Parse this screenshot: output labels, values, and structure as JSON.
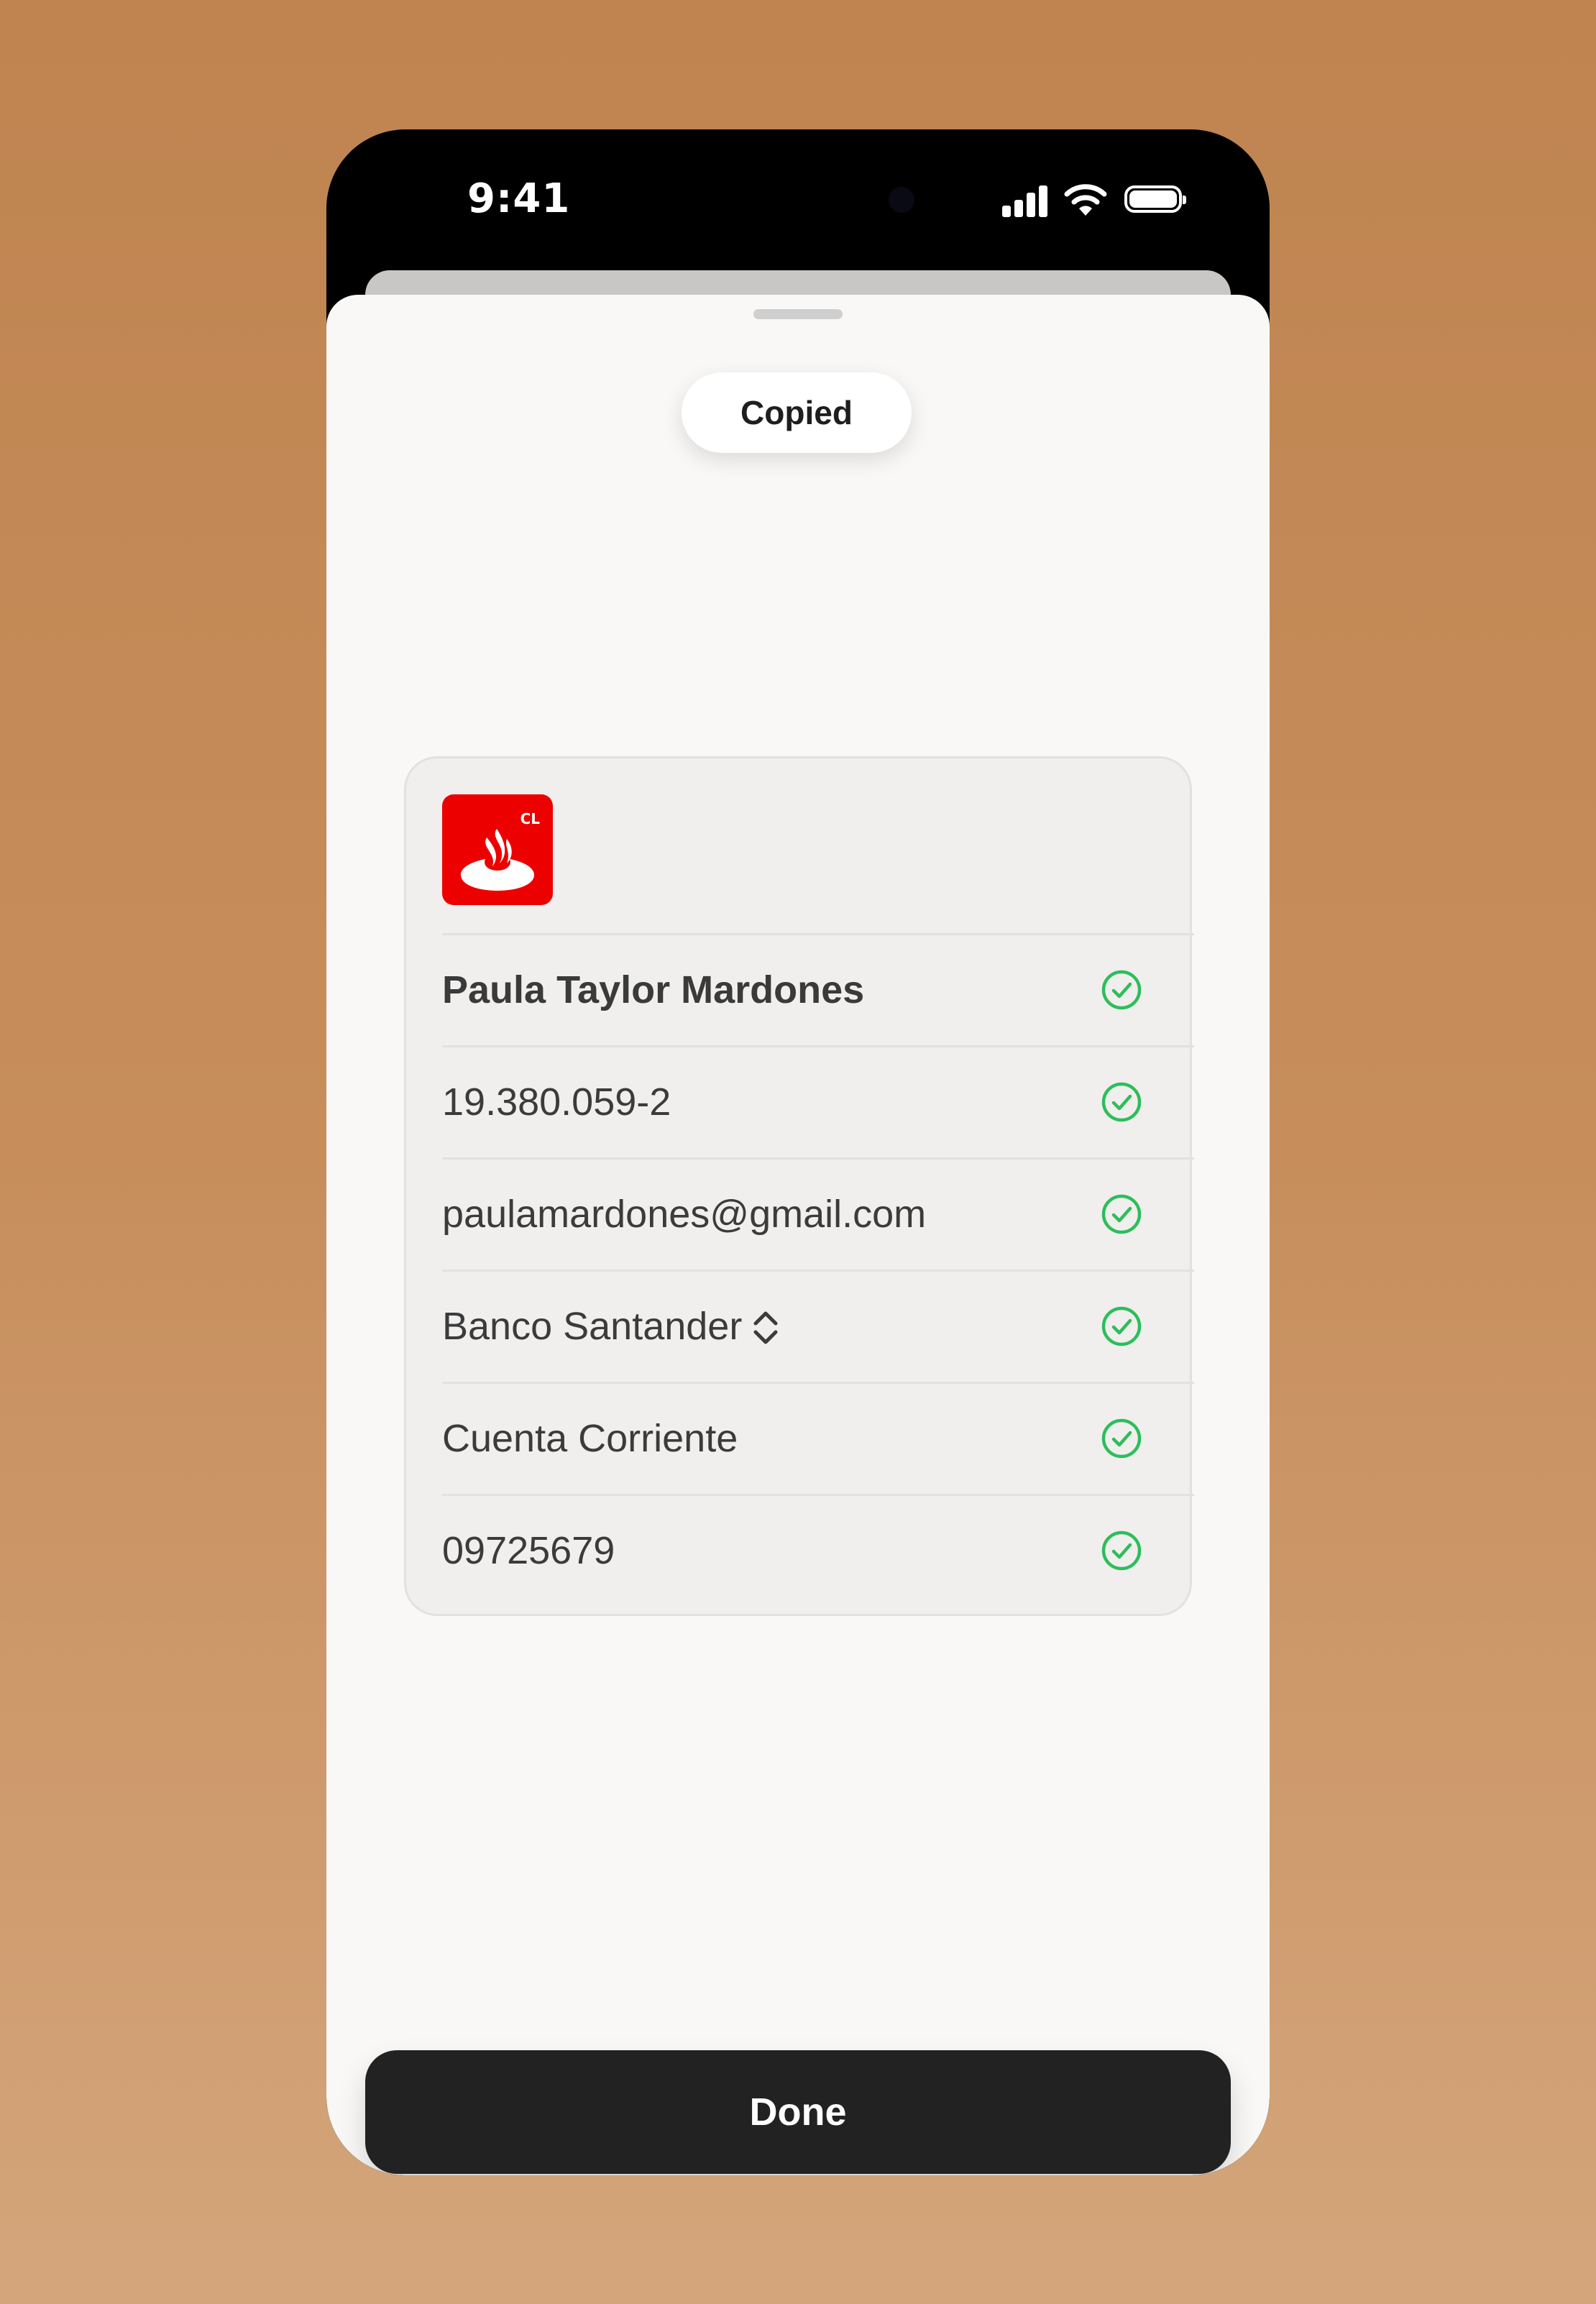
{
  "status_bar": {
    "time": "9:41"
  },
  "toast": {
    "label": "Copied"
  },
  "bank_logo": {
    "region": "CL",
    "brand_color": "#EC0000"
  },
  "rows": [
    {
      "label": "Paula Taylor Mardones",
      "bold": true
    },
    {
      "label": "19.380.059-2"
    },
    {
      "label": "paulamardones@gmail.com"
    },
    {
      "label": "Banco Santander",
      "has_chevron": true
    },
    {
      "label": "Cuenta Corriente"
    },
    {
      "label": "09725679"
    }
  ],
  "done_button": {
    "label": "Done"
  },
  "colors": {
    "check": "#2DBE5A",
    "button": "#222222",
    "background": "#C78E5C"
  }
}
